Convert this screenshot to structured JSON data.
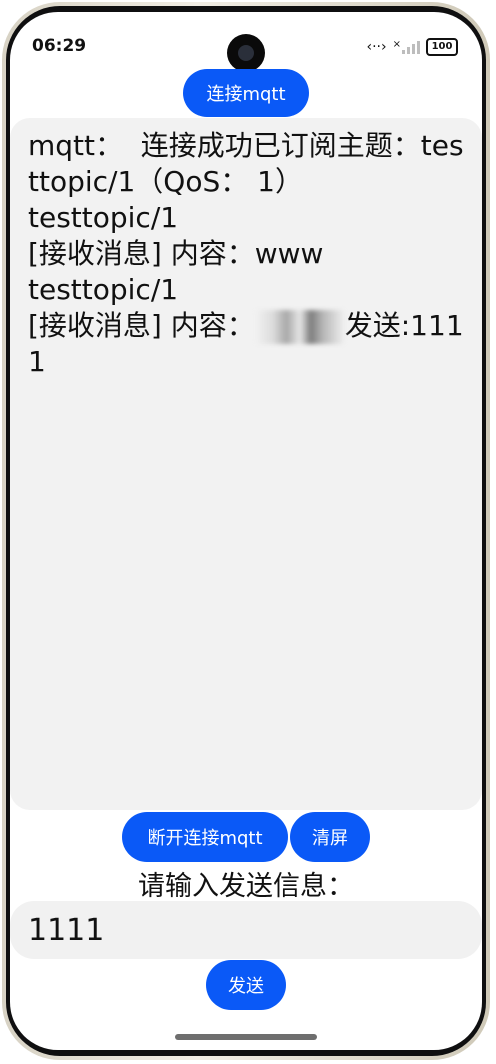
{
  "status_bar": {
    "time": "06:29",
    "nfc_glyph": "‹··›",
    "no_signal_mark": "×",
    "battery": "100"
  },
  "buttons": {
    "connect": "连接mqtt",
    "disconnect": "断开连接mqtt",
    "clear": "清屏",
    "send": "发送"
  },
  "log": {
    "line1": "mqtt：  连接成功已订阅主题：testtopic/1（QoS： 1）",
    "line2": "testtopic/1",
    "line3": "[接收消息] 内容：www",
    "line4": "",
    "line5": "testtopic/1",
    "line6_prefix": "[接收消息] 内容：",
    "line6_suffix": "发送:1111"
  },
  "prompt_label": "请输入发送信息：",
  "input": {
    "value": "1111"
  },
  "colors": {
    "accent": "#0a59f7",
    "panel": "#f2f2f2"
  },
  "icons": [
    "camera-icon",
    "nfc-icon",
    "signal-icon",
    "battery-icon"
  ]
}
